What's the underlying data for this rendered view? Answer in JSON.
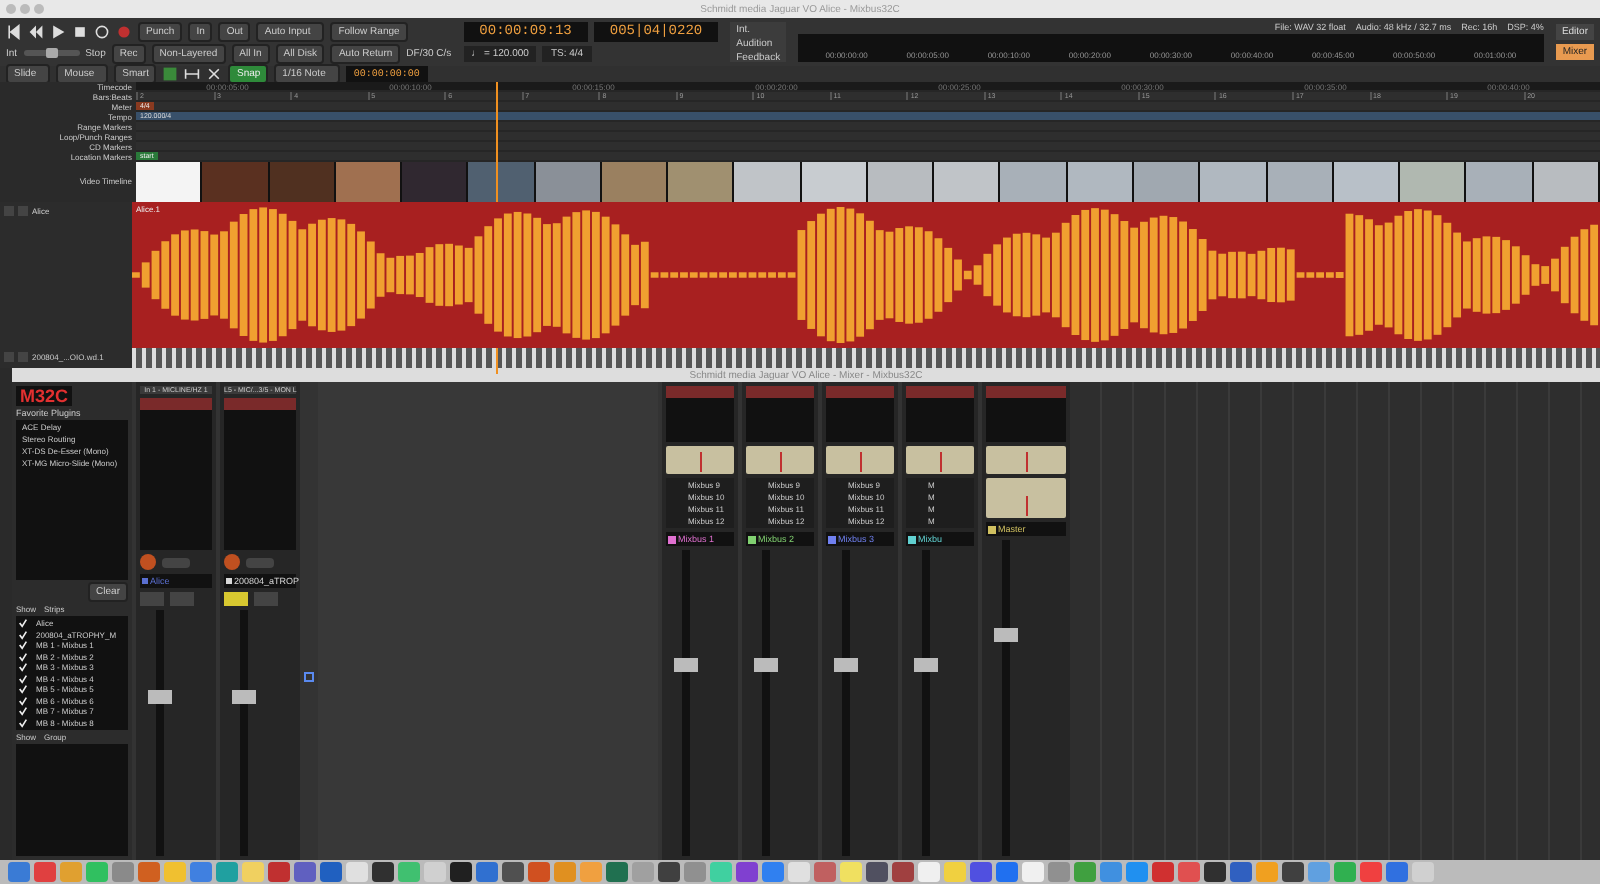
{
  "window": {
    "title": "Schmidt media Jaguar VO Alice - Mixbus32C"
  },
  "shuttle": {
    "level": 0.5
  },
  "transport": {
    "row1": [
      "Punch",
      "In",
      "Out"
    ],
    "auto_input": "Auto Input",
    "follow_range": "Follow Range",
    "row2_left": "Int",
    "row2_stop": "Stop",
    "row2": [
      "Rec",
      "Non-Layered",
      "All In",
      "All Disk",
      "Auto Return"
    ],
    "fps": "DF/30 C/s",
    "clock": "00:00:09:13",
    "bbt": "005|04|0220",
    "tempo": "♩ = 120.000",
    "meter": "TS: 4/4",
    "sync": [
      "Int.",
      "Audition",
      "Feedback"
    ]
  },
  "status": [
    "File: WAV 32 float",
    "Audio: 48 kHz / 32.7 ms",
    "Rec: 16h",
    "DSP: 4%"
  ],
  "views": [
    {
      "label": "Editor",
      "selected": false
    },
    {
      "label": "Mixer",
      "selected": true
    }
  ],
  "mini_timeline": [
    "00:00:00:00",
    "00:00:05:00",
    "00:00:10:00",
    "00:00:20:00",
    "00:00:30:00",
    "00:00:40:00",
    "00:00:45:00",
    "00:00:50:00",
    "00:01:00:00"
  ],
  "edit_toolbar": {
    "mode": "Slide",
    "tool": "Mouse",
    "edit": "Smart",
    "snap": {
      "label": "Snap",
      "on": true
    },
    "grid": "1/16 Note",
    "nudge": "00:00:00:00"
  },
  "rulers": [
    "Timecode",
    "Bars:Beats",
    "Meter",
    "Tempo",
    "Range Markers",
    "Loop/Punch Ranges",
    "CD Markers",
    "Location Markers",
    "Video Timeline"
  ],
  "timecodes": [
    "00:00:05:00",
    "00:00:10:00",
    "00:00:15:00",
    "00:00:20:00",
    "00:00:25:00",
    "00:00:30:00",
    "00:00:35:00",
    "00:00:40:00"
  ],
  "bars": [
    "2",
    "3",
    "4",
    "5",
    "6",
    "7",
    "8",
    "9",
    "10",
    "11",
    "12",
    "13",
    "14",
    "15",
    "16",
    "17",
    "18",
    "19",
    "20"
  ],
  "meter": "4/4",
  "tempo": "120.000/4",
  "location_markers": [
    "start"
  ],
  "tracks": [
    {
      "name": "Alice",
      "region": "Alice.1",
      "kind": "main"
    },
    {
      "name": "200804_...OIO.wd.1",
      "kind": "small"
    }
  ],
  "mixer": {
    "title": "Schmidt media Jaguar VO Alice - Mixer - Mixbus32C",
    "logo": "M32C",
    "favorites_title": "Favorite Plugins",
    "favorites": [
      "ACE Delay",
      "Stereo Routing",
      "XT-DS De-Esser (Mono)",
      "XT-MG Micro-Slide (Mono)"
    ],
    "clear": "Clear",
    "strips_header": [
      "Show",
      "Strips"
    ],
    "strip_list": [
      {
        "name": "Alice",
        "checked": true
      },
      {
        "name": "200804_aTROPHY_M",
        "checked": true
      },
      {
        "name": "MB 1 - Mixbus 1",
        "checked": true
      },
      {
        "name": "MB 2 - Mixbus 2",
        "checked": true
      },
      {
        "name": "MB 3 - Mixbus 3",
        "checked": true
      },
      {
        "name": "MB 4 - Mixbus 4",
        "checked": true
      },
      {
        "name": "MB 5 - Mixbus 5",
        "checked": true
      },
      {
        "name": "MB 6 - Mixbus 6",
        "checked": true
      },
      {
        "name": "MB 7 - Mixbus 7",
        "checked": true
      },
      {
        "name": "MB 8 - Mixbus 8",
        "checked": true
      }
    ],
    "groups_header": [
      "Show",
      "Group"
    ],
    "strips": [
      {
        "kind": "track",
        "input": "In 1 - MICLINE/HZ 1",
        "name": "Alice",
        "color": "#5a6fd0",
        "mute": false,
        "level": 0.62
      },
      {
        "kind": "track",
        "input": "L5 - MIC/...3/5 - MON L",
        "name": "200804_aTROP",
        "color": "#d8d8d8",
        "mute": true,
        "level": 0.62
      }
    ],
    "buses": [
      {
        "kind": "mixbus",
        "name": "Mixbus 1",
        "color": "#e070d0",
        "sends": [
          "Mixbus 9",
          "Mixbus 10",
          "Mixbus 11",
          "Mixbus 12"
        ],
        "level": 0.6
      },
      {
        "kind": "mixbus",
        "name": "Mixbus 2",
        "color": "#80d070",
        "sends": [
          "Mixbus 9",
          "Mixbus 10",
          "Mixbus 11",
          "Mixbus 12"
        ],
        "level": 0.6
      },
      {
        "kind": "mixbus",
        "name": "Mixbus 3",
        "color": "#7080f0",
        "sends": [
          "Mixbus 9",
          "Mixbus 10",
          "Mixbus 11",
          "Mixbus 12"
        ],
        "level": 0.6
      },
      {
        "kind": "mixbus",
        "name": "Mixbu",
        "color": "#60d0d0",
        "sends": [
          "M",
          "M",
          "M",
          "M"
        ],
        "level": 0.6
      },
      {
        "kind": "master",
        "name": "Master",
        "color": "#d0c060",
        "level": 0.68
      }
    ]
  }
}
